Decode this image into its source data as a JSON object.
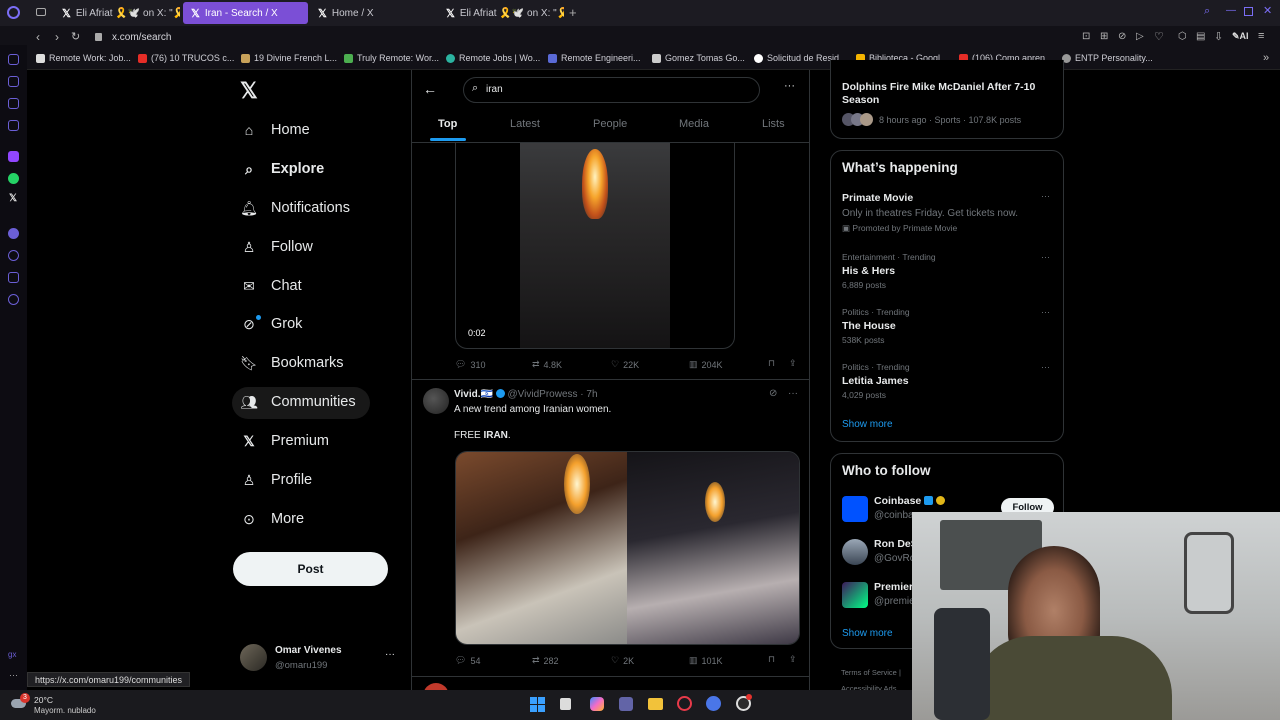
{
  "browser": {
    "tabs": [
      {
        "label": "Eli Afriat 🎗️🕊️ on X: \"🎗️BR"
      },
      {
        "label": "Iran - Search / X"
      },
      {
        "label": "Home / X"
      },
      {
        "label": "Eli Afriat 🎗️🕊️ on X: \"🎗️BR"
      }
    ],
    "url": "x.com/search",
    "address_right_label": "AI",
    "bookmarks": [
      "Remote Work: Job...",
      "(76) 10 TRUCOS c...",
      "19 Divine French L...",
      "Truly Remote: Wor...",
      "Remote Jobs | Wo...",
      "Remote Engineeri...",
      "Gomez Tomas Go...",
      "Solicitud de Resid...",
      "Biblioteca - Googl...",
      "(106) Como apren...",
      "ENTP Personality..."
    ]
  },
  "nav": {
    "items": [
      "Home",
      "Explore",
      "Notifications",
      "Follow",
      "Chat",
      "Grok",
      "Bookmarks",
      "Communities",
      "Premium",
      "Profile",
      "More"
    ],
    "post_button": "Post",
    "account_name": "Omar Vivenes",
    "account_handle": "@omaru199"
  },
  "search": {
    "query": "iran",
    "tabs": [
      "Top",
      "Latest",
      "People",
      "Media",
      "Lists"
    ]
  },
  "post1": {
    "video_time": "0:02",
    "replies": "310",
    "reposts": "4.8K",
    "likes": "22K",
    "views": "204K"
  },
  "post2": {
    "author": "Vivid.🇮🇱",
    "handle": "@VividProwess",
    "time": "· 7h",
    "text1": "A new trend among Iranian women.",
    "text2_prefix": "FREE ",
    "text2_bold": "IRAN",
    "text2_suffix": ".",
    "replies": "54",
    "reposts": "282",
    "likes": "2K",
    "views": "101K"
  },
  "right": {
    "top_trend_title": "Dolphins Fire Mike McDaniel After 7-10 Season",
    "top_trend_meta": "8 hours ago · Sports · 107.8K posts",
    "happening_title": "What’s happening",
    "promo_title": "Primate Movie",
    "promo_desc": "Only in theatres Friday. Get tickets now.",
    "promo_by": "Promoted by Primate Movie",
    "trends": [
      {
        "meta": "Entertainment · Trending",
        "title": "His & Hers",
        "posts": "6,889 posts"
      },
      {
        "meta": "Politics · Trending",
        "title": "The House",
        "posts": "538K posts"
      },
      {
        "meta": "Politics · Trending",
        "title": "Letitia James",
        "posts": "4,029 posts"
      }
    ],
    "show_more": "Show more",
    "who_title": "Who to follow",
    "follow": [
      {
        "name": "Coinbase",
        "handle": "@coinba",
        "button": "Follow"
      },
      {
        "name": "Ron DeS",
        "handle": "@GovRo"
      },
      {
        "name": "Premier",
        "handle": "@premie"
      }
    ],
    "show_more2": "Show more",
    "footer": [
      "Terms of Service",
      "|",
      "Accessibility",
      "Ads"
    ]
  },
  "status_url": "https://x.com/omaru199/communities",
  "weather": {
    "temp": "20°C",
    "desc": "Mayorm. nublado",
    "badge": "3"
  },
  "colors": {
    "accent": "#1d9bf0",
    "tab_active": "#7b4fd6",
    "bg": "#000000"
  }
}
